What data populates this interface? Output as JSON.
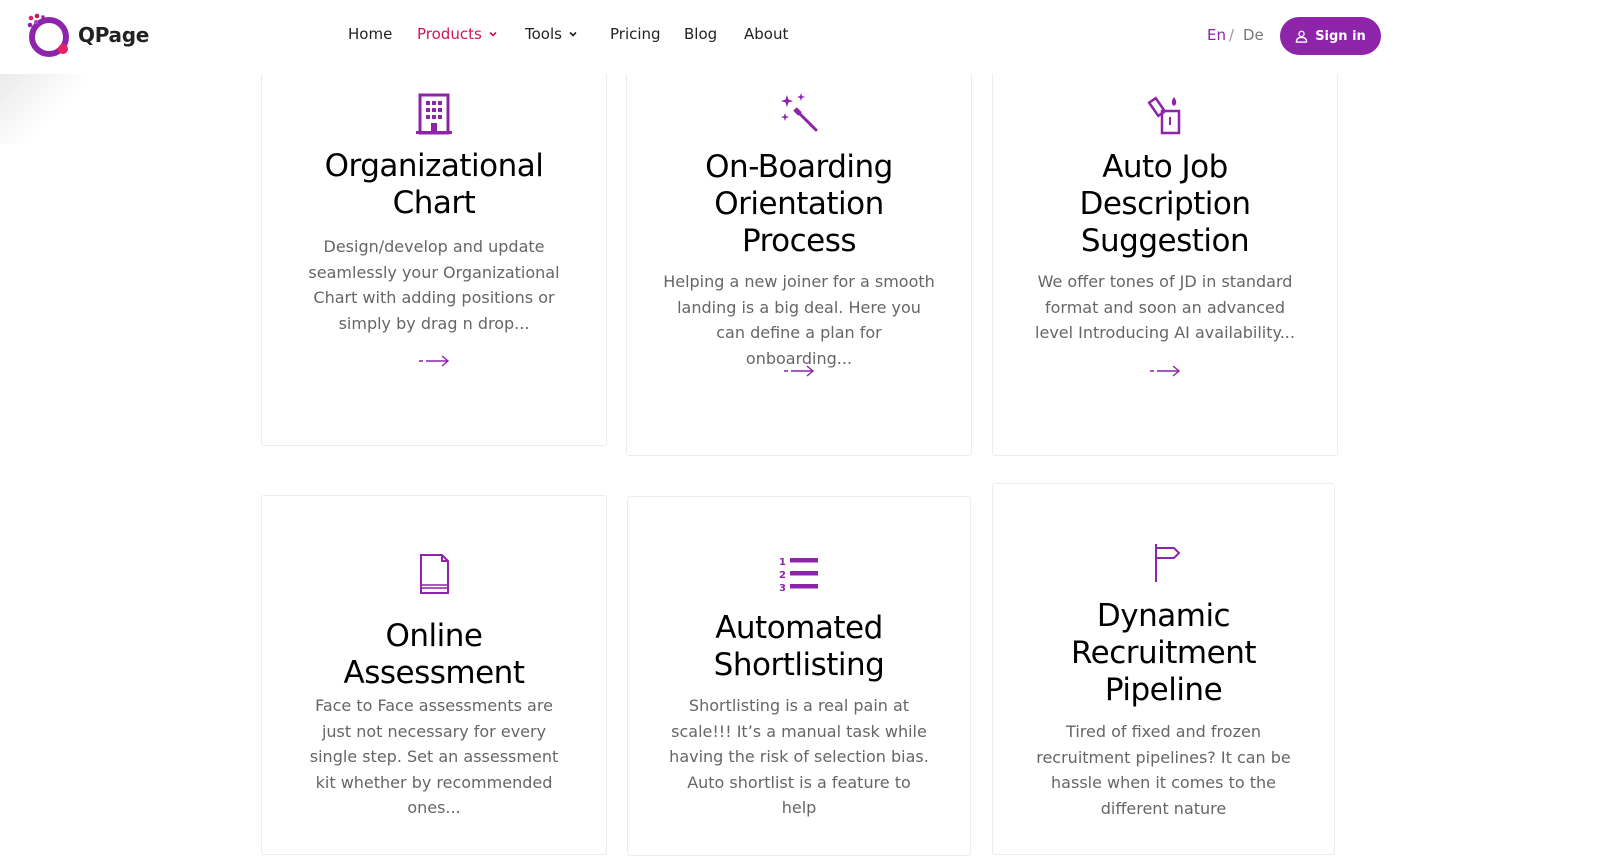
{
  "header": {
    "logo_text": "QPage",
    "nav": [
      {
        "label": "Home",
        "active": false,
        "dropdown": false
      },
      {
        "label": "Products",
        "active": true,
        "dropdown": true
      },
      {
        "label": "Tools",
        "active": false,
        "dropdown": true
      },
      {
        "label": "Pricing",
        "active": false,
        "dropdown": false
      },
      {
        "label": "Blog",
        "active": false,
        "dropdown": false
      },
      {
        "label": "About",
        "active": false,
        "dropdown": false
      }
    ],
    "lang_en": "En",
    "lang_sep": "/",
    "lang_de": "De",
    "signin_label": "Sign in"
  },
  "colors": {
    "accent": "#8e24aa",
    "active_nav": "#d4145a"
  },
  "cards": [
    {
      "icon": "building-icon",
      "title_lines": [
        "Organizational",
        "Chart"
      ],
      "text": "Design/develop and update seamlessly your Organizational Chart with adding positions or simply by drag n drop..."
    },
    {
      "icon": "magic-wand-icon",
      "title_lines": [
        "On-Boarding",
        "Orientation",
        "Process"
      ],
      "text": "Helping a new joiner for a smooth landing is a big deal. Here you can define a plan for onboarding..."
    },
    {
      "icon": "lighter-icon",
      "title_lines": [
        "Auto Job",
        "Description",
        "Suggestion"
      ],
      "text": "We offer tones of JD in standard format and soon an advanced level Introducing AI availability..."
    },
    {
      "icon": "document-icon",
      "title_lines": [
        "Online",
        "Assessment"
      ],
      "text": "Face to Face assessments are just not necessary for every single step. Set an assessment kit whether by recommended ones..."
    },
    {
      "icon": "numbered-list-icon",
      "title_lines": [
        "Automated",
        "Shortlisting"
      ],
      "text": "Shortlisting is a real pain at scale!!! It’s a manual task while having the risk of selection bias. Auto shortlist is a feature to help"
    },
    {
      "icon": "signpost-icon",
      "title_lines": [
        "Dynamic",
        "Recruitment",
        "Pipeline"
      ],
      "text": "Tired of fixed and frozen recruitment pipelines? It can be hassle when it comes to the different nature"
    }
  ]
}
